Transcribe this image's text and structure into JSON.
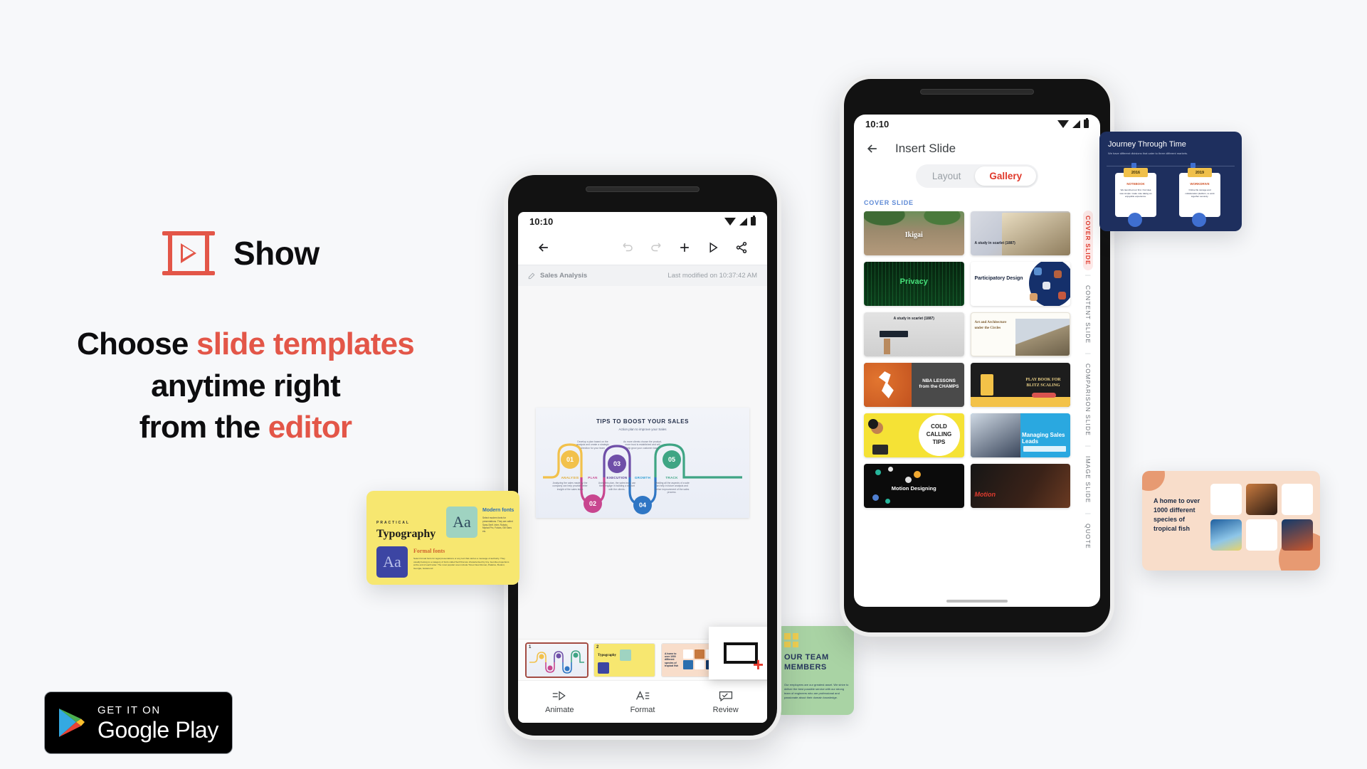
{
  "brand": {
    "name": "Show",
    "icon": "presentation-play-icon",
    "accent": "#e35648"
  },
  "headline": {
    "line1_a": "Choose ",
    "line1_b": "slide templates",
    "line2": "anytime right",
    "line3_a": "from the ",
    "line3_b": "editor"
  },
  "store_badge": {
    "small": "GET IT ON",
    "big": "Google Play",
    "icon": "google-play-icon"
  },
  "phone_left": {
    "status": {
      "time": "10:10",
      "icons": [
        "wifi-icon",
        "signal-icon",
        "battery-icon"
      ]
    },
    "toolbar": {
      "back": "back-arrow-icon",
      "undo": "undo-icon",
      "redo": "redo-icon",
      "add": "plus-icon",
      "present": "play-icon",
      "share": "share-icon"
    },
    "doc": {
      "name": "Sales Analysis",
      "modified": "Last modified on 10:37:42 AM",
      "edit_icon": "pencil-icon"
    },
    "slide": {
      "title": "TIPS TO BOOST YOUR SALES",
      "subtitle": "Action plan to improve your Sales",
      "steps": [
        {
          "num": "01",
          "label": "ANALYSIS",
          "color": "#f2c14b",
          "text": "Analyzing the sales made by the company can help provide better insight of the sales team"
        },
        {
          "num": "02",
          "label": "PLAN",
          "color": "#c8468f",
          "text": "Develop a plan based on the analysis and create a strategic direction for your team"
        },
        {
          "num": "03",
          "label": "EXECUTION",
          "color": "#6f4fa8",
          "text": "Using this plan, the sales team can then engage in building a rapport with the clients."
        },
        {
          "num": "04",
          "label": "GROWTH",
          "color": "#2f76c4",
          "text": "As more clients choose the product, more trust is established and will help grow your customer base."
        },
        {
          "num": "05",
          "label": "TRACK",
          "color": "#3fa584",
          "text": "Detailing all the aspects of a sale can help in future analysis and further improvement of the sales process."
        }
      ]
    },
    "thumbnails": [
      {
        "number": "1",
        "selected": true
      },
      {
        "number": "2",
        "selected": false
      },
      {
        "number": "3",
        "selected": false
      }
    ],
    "add_slide_popup": {
      "icon": "add-slide-icon",
      "plus": "+"
    },
    "bottom_nav": [
      {
        "label": "Animate",
        "icon": "animate-icon"
      },
      {
        "label": "Format",
        "icon": "format-text-icon"
      },
      {
        "label": "Review",
        "icon": "review-icon"
      }
    ]
  },
  "phone_right": {
    "status": {
      "time": "10:10",
      "icons": [
        "wifi-icon",
        "signal-icon",
        "battery-icon"
      ]
    },
    "header": {
      "back": "back-arrow-icon",
      "title": "Insert Slide"
    },
    "tabs": [
      {
        "label": "Layout",
        "active": false
      },
      {
        "label": "Gallery",
        "active": true
      }
    ],
    "section_title": "COVER SLIDE",
    "gallery": [
      {
        "title": "Ikigai",
        "kind": "photo-floral"
      },
      {
        "title": "A study in scarlet (1887)",
        "kind": "photo-books"
      },
      {
        "title": "Privacy",
        "kind": "dark-matrix"
      },
      {
        "title": "Participatory Design",
        "kind": "avatars-navy"
      },
      {
        "title": "A study in scarlet (1887)",
        "kind": "photo-roller"
      },
      {
        "title": "Art and Architecture under the Circles",
        "kind": "photo-temple"
      },
      {
        "title": "NBA LESSONS from the CHAMPS",
        "kind": "basketball"
      },
      {
        "title": "PLAY BOOK FOR BLITZ SCALING",
        "kind": "book-yellow"
      },
      {
        "title": "COLD CALLING TIPS",
        "kind": "yellow-phone"
      },
      {
        "title": "Managing Sales Leads",
        "kind": "blue-laptop"
      },
      {
        "title": "Motion Designing",
        "kind": "dark-dots"
      },
      {
        "title": "Motion",
        "kind": "dark-camera"
      }
    ],
    "rail": [
      {
        "label": "COVER SLIDE",
        "active": true
      },
      {
        "label": "CONTENT SLIDE",
        "active": false
      },
      {
        "label": "COMPARISON SLIDE",
        "active": false
      },
      {
        "label": "IMAGE SLIDE",
        "active": false
      },
      {
        "label": "QUOTE",
        "active": false
      }
    ]
  },
  "floating_cards": {
    "typography": {
      "eyebrow": "PRACTICAL",
      "title": "Typography",
      "block1_title": "Modern fonts",
      "block1_text": "Select modern fonts for presentations. They are called Sans-Serif. Inter, Roboto, Myriad Pro, Futura, Gill Sans etc.",
      "block2_title": "Formal fonts",
      "block2_text": "Select formal fonts for legal presentations or any text that carries a message of authority. They usually belong to a category of fonts called Serif that are characterised by tiny, feet-like projections at the end of each letter. The most popular ones include Times New Roman, Palatino, Bodoni, Georgia, Garamond",
      "glyph": "Aa"
    },
    "timeline": {
      "title": "Journey Through Time",
      "subtitle": "We have different divisions that cater to three different markets.",
      "items": [
        {
          "year": "2016",
          "label": "NOTEBOOK",
          "text": "We launched our first. Our idea was simple: make note taking an enjoyable experience."
        },
        {
          "year": "2019",
          "label": "WORKDRIVE",
          "text": "Online file storage and collaboration platform, to work together securely."
        }
      ]
    },
    "fish": {
      "headline": "A home to over 1000 different species of tropical fish"
    },
    "team": {
      "title": "OUR TEAM MEMBERS",
      "text": "Our employees are our greatest asset. We strive to deliver the best possible service with our strong team of engineers who are professional and passionate about their domain knowledge."
    }
  }
}
